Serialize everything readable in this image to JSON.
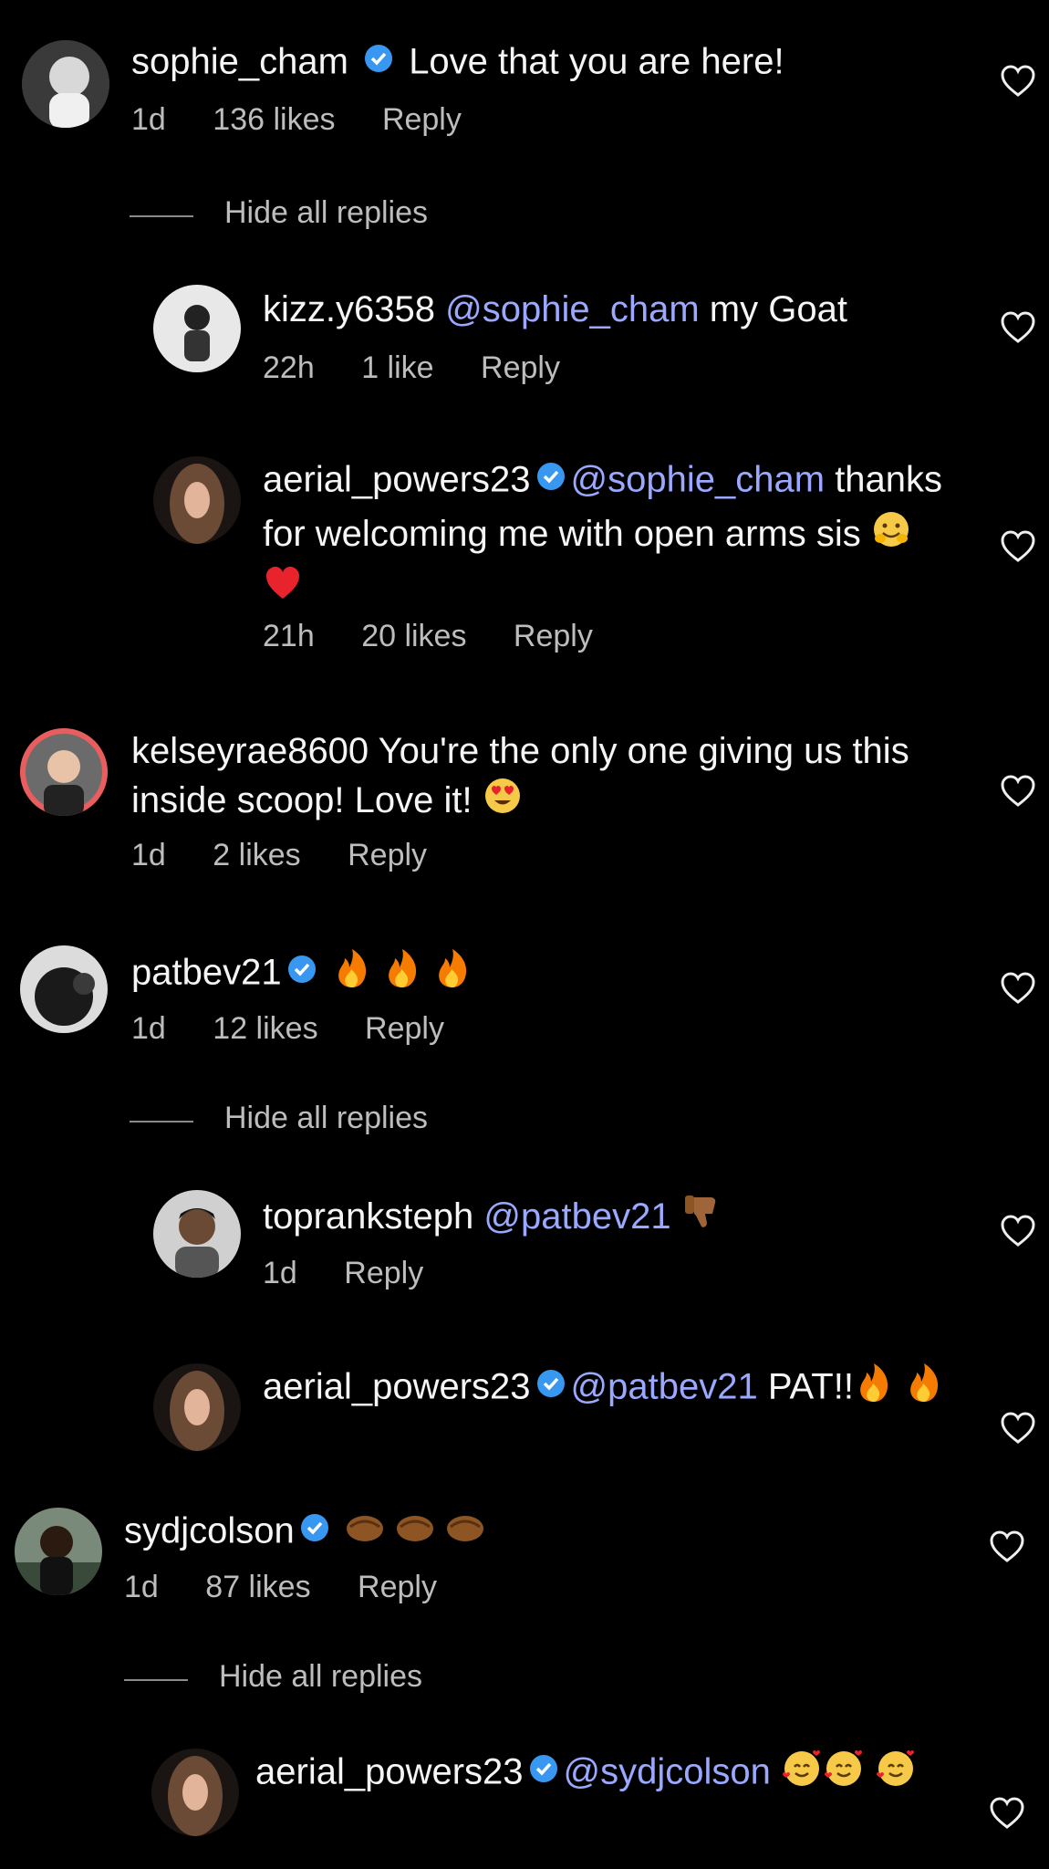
{
  "comments": [
    {
      "user": "sophie_cham",
      "verified": true,
      "text": "Love that you are here!",
      "time": "1d",
      "likes": "136 likes",
      "reply": "Reply"
    },
    {
      "hide_replies": "Hide all replies"
    },
    {
      "user": "kizz.y6358",
      "mention": "@sophie_cham",
      "text": "my Goat",
      "time": "22h",
      "likes": "1 like",
      "reply": "Reply"
    },
    {
      "user": "aerial_powers23",
      "verified": true,
      "mention": "@sophie_cham",
      "text": "thanks for welcoming me with open arms sis",
      "time": "21h",
      "likes": "20 likes",
      "reply": "Reply"
    },
    {
      "user": "kelseyrae8600",
      "text": "You're the only one giving us this inside scoop! Love it!",
      "time": "1d",
      "likes": "2 likes",
      "reply": "Reply"
    },
    {
      "user": "patbev21",
      "verified": true,
      "time": "1d",
      "likes": "12 likes",
      "reply": "Reply"
    },
    {
      "hide_replies": "Hide all replies"
    },
    {
      "user": "toprankst eph",
      "mention": "@patbev21",
      "time": "1d",
      "reply": "Reply"
    },
    {
      "user": "aerial_powers23",
      "verified": true,
      "mention": "@patbev21",
      "text": "PAT!!"
    },
    {
      "user": "sydjcolson",
      "verified": true,
      "time": "1d",
      "likes": "87 likes",
      "reply": "Reply"
    },
    {
      "hide_replies": "Hide all replies"
    },
    {
      "user": "aerial_powers23",
      "verified": true,
      "mention": "@sydjcolson"
    }
  ],
  "icons": {
    "heart": "heart-outline-icon",
    "verified": "verified-badge-icon"
  },
  "colors": {
    "background": "#000000",
    "mention": "#9aa8ff",
    "verified": "#3897f0"
  }
}
